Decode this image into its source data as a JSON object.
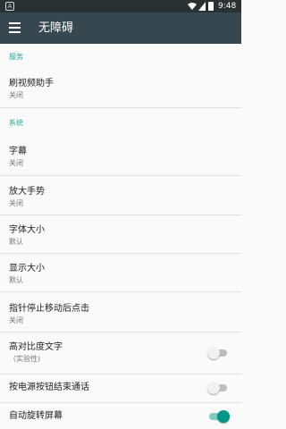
{
  "status_bar": {
    "notification_glyph": "A",
    "time": "9:48",
    "icons": [
      "wifi-icon",
      "signal-icon",
      "battery-icon"
    ]
  },
  "toolbar": {
    "title": "无障碍",
    "menu_icon": "hamburger-menu-icon"
  },
  "colors": {
    "toolbar": "#37474f",
    "status_bar": "#2a3133",
    "accent": "#009688",
    "section_header": "#26a69a"
  },
  "sections": [
    {
      "header": "服务",
      "items": [
        {
          "title": "刷视频助手",
          "summary": "关闭"
        }
      ]
    },
    {
      "header": "系统",
      "items": [
        {
          "title": "字幕",
          "summary": "关闭"
        },
        {
          "title": "放大手势",
          "summary": "关闭"
        },
        {
          "title": "字体大小",
          "summary": "默认"
        },
        {
          "title": "显示大小",
          "summary": "默认"
        },
        {
          "title": "指针停止移动后点击",
          "summary": "关闭"
        },
        {
          "title": "高对比度文字",
          "summary": "（实验性)",
          "switch": false
        },
        {
          "title": "按电源按钮结束通话",
          "switch": false
        },
        {
          "title": "自动旋转屏幕",
          "switch": true
        }
      ]
    }
  ]
}
